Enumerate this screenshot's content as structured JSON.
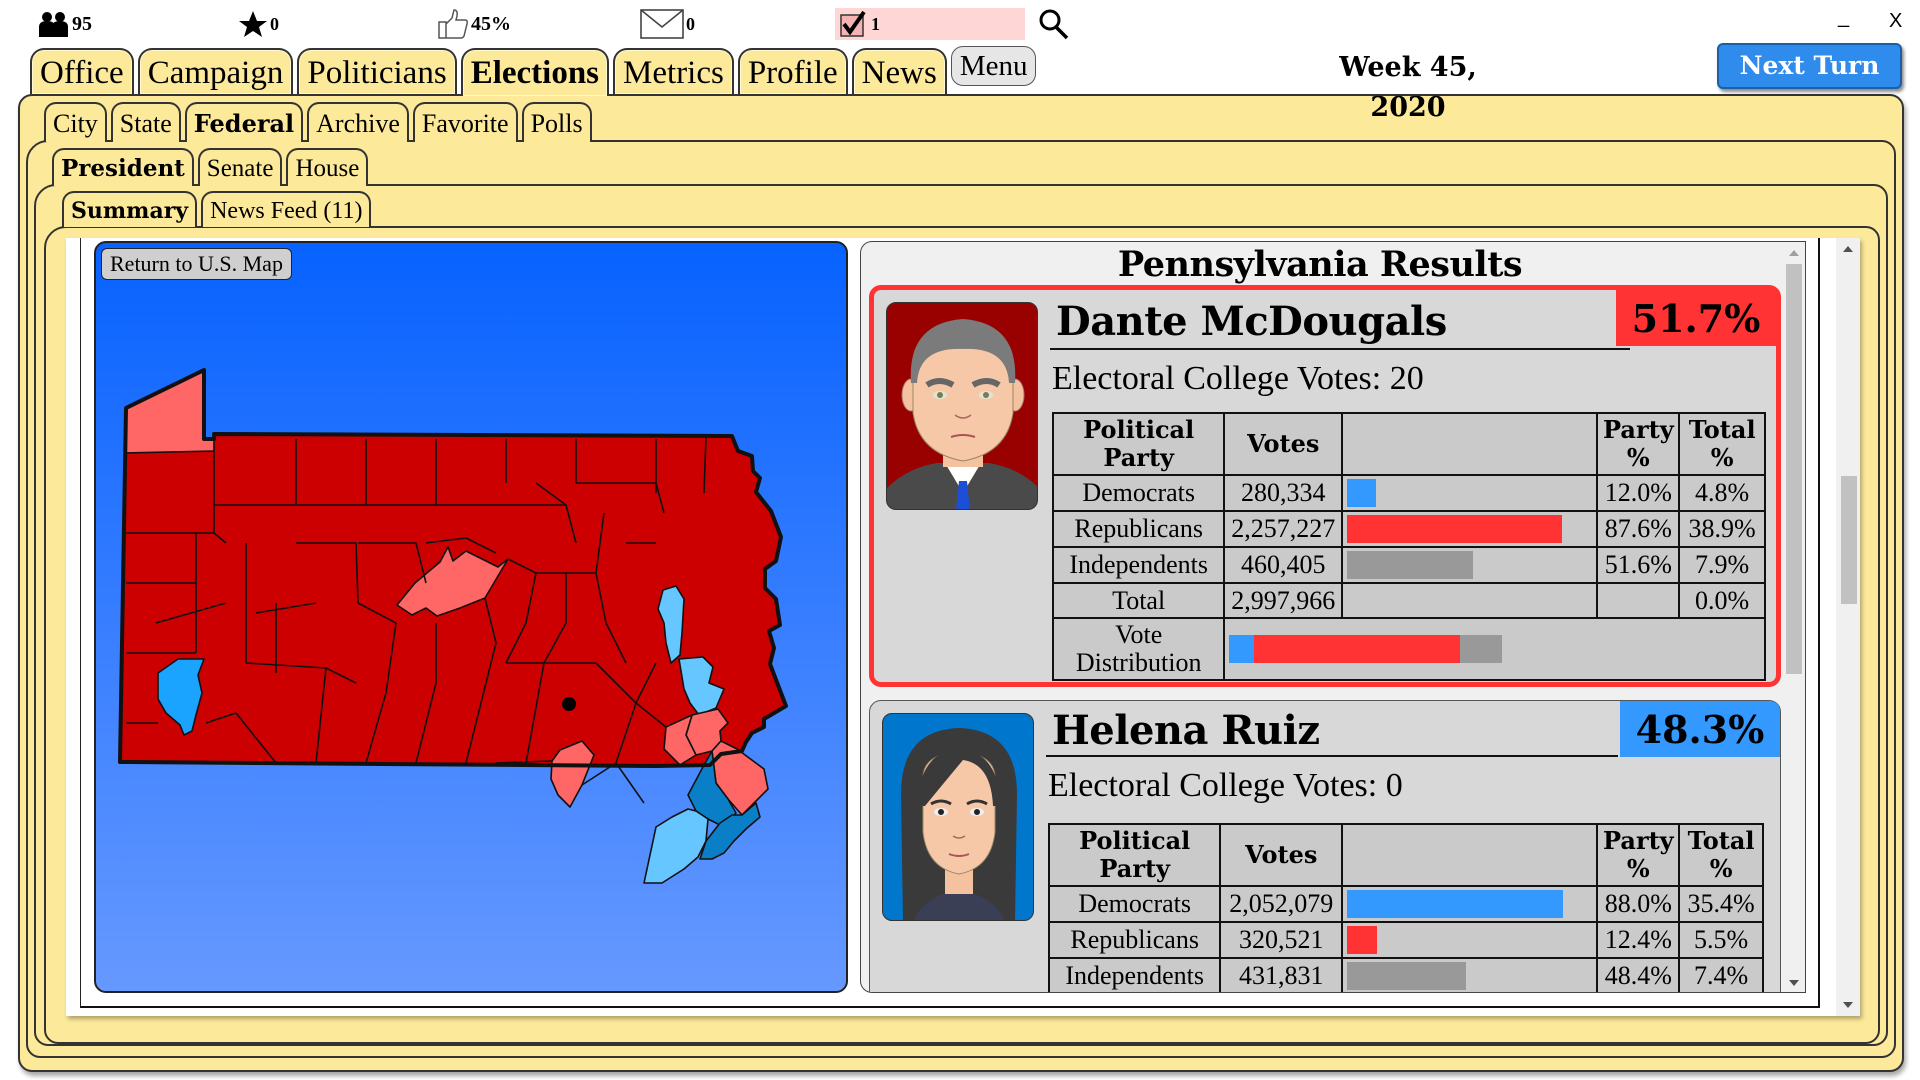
{
  "status_bar": {
    "population": {
      "icon": "people-icon",
      "value": "95"
    },
    "stars": {
      "icon": "star-icon",
      "value": "0"
    },
    "approval": {
      "icon": "thumbs-up-icon",
      "value": "45%"
    },
    "messages": {
      "icon": "envelope-icon",
      "value": "0"
    },
    "tasks": {
      "icon": "checkbox-icon",
      "value": "1"
    },
    "search": {
      "icon": "search-icon"
    }
  },
  "window": {
    "minimize": "_",
    "close": "X"
  },
  "main_tabs": [
    {
      "label": "Office",
      "active": false
    },
    {
      "label": "Campaign",
      "active": false
    },
    {
      "label": "Politicians",
      "active": false
    },
    {
      "label": "Elections",
      "active": true
    },
    {
      "label": "Metrics",
      "active": false
    },
    {
      "label": "Profile",
      "active": false
    },
    {
      "label": "News",
      "active": false
    }
  ],
  "menu_label": "Menu",
  "week_label": "Week 45, 2020",
  "next_turn_label": "Next Turn",
  "election_tabs": [
    {
      "label": "City"
    },
    {
      "label": "State"
    },
    {
      "label": "Federal",
      "active": true
    },
    {
      "label": "Archive"
    },
    {
      "label": "Favorite"
    },
    {
      "label": "Polls"
    }
  ],
  "federal_tabs": [
    {
      "label": "President",
      "active": true
    },
    {
      "label": "Senate"
    },
    {
      "label": "House"
    }
  ],
  "view_tabs": [
    {
      "label": "Summary",
      "active": true
    },
    {
      "label": "News Feed (11)"
    }
  ],
  "map": {
    "return_label": "Return to U.S. Map",
    "state": "Pennsylvania",
    "colors": {
      "strong_rep": "#cc0000",
      "lean_rep": "#ff6666",
      "lean_dem": "#66c6ff",
      "dem": "#1aa3ff",
      "strong_dem": "#0a7fc8",
      "border": "#111111"
    }
  },
  "results": {
    "title": "Pennsylvania Results",
    "columns": {
      "party": "Political Party",
      "votes": "Votes",
      "party_pct": "Party %",
      "total_pct": "Total %"
    },
    "candidates": [
      {
        "name": "Dante McDougals",
        "share": "51.7%",
        "color": "#ff3333",
        "electoral_label": "Electoral College Votes: 20",
        "rows": [
          {
            "party": "Democrats",
            "votes": "2 80,334",
            "party_pct": "12.0%",
            "total_pct": "4.8%",
            "bar_fraction": 0.12,
            "bar_color": "#3399ff"
          },
          {
            "party": "Republicans",
            "votes": "2,257,227",
            "party_pct": "87.6%",
            "total_pct": "38.9%",
            "bar_fraction": 0.876,
            "bar_color": "#ff3333"
          },
          {
            "party": "Independents",
            "votes": "460,405",
            "party_pct": "51.6%",
            "total_pct": "7.9%",
            "bar_fraction": 0.516,
            "bar_color": "#999999"
          }
        ],
        "total": {
          "label": "Total",
          "votes": "2,997,966",
          "total_pct": "0.0%"
        },
        "distribution_label": "Vote Distribution",
        "distribution": [
          {
            "party": "Democrats",
            "fraction": 0.048,
            "color": "#3399ff"
          },
          {
            "party": "Republicans",
            "fraction": 0.389,
            "color": "#ff3333"
          },
          {
            "party": "Independents",
            "fraction": 0.079,
            "color": "#999999"
          }
        ]
      },
      {
        "name": "Helena Ruiz",
        "share": "48.3%",
        "color": "#3399ff",
        "electoral_label": "Electoral College Votes: 0",
        "rows": [
          {
            "party": "Democrats",
            "votes": "2,052,079",
            "party_pct": "88.0%",
            "total_pct": "35.4%",
            "bar_fraction": 0.88,
            "bar_color": "#3399ff"
          },
          {
            "party": "Republicans",
            "votes": "320,521",
            "party_pct": "12.4%",
            "total_pct": "5.5%",
            "bar_fraction": 0.124,
            "bar_color": "#ff3333"
          },
          {
            "party": "Independents",
            "votes": "431,831",
            "party_pct": "48.4%",
            "total_pct": "7.4%",
            "bar_fraction": 0.484,
            "bar_color": "#999999"
          }
        ]
      }
    ]
  }
}
